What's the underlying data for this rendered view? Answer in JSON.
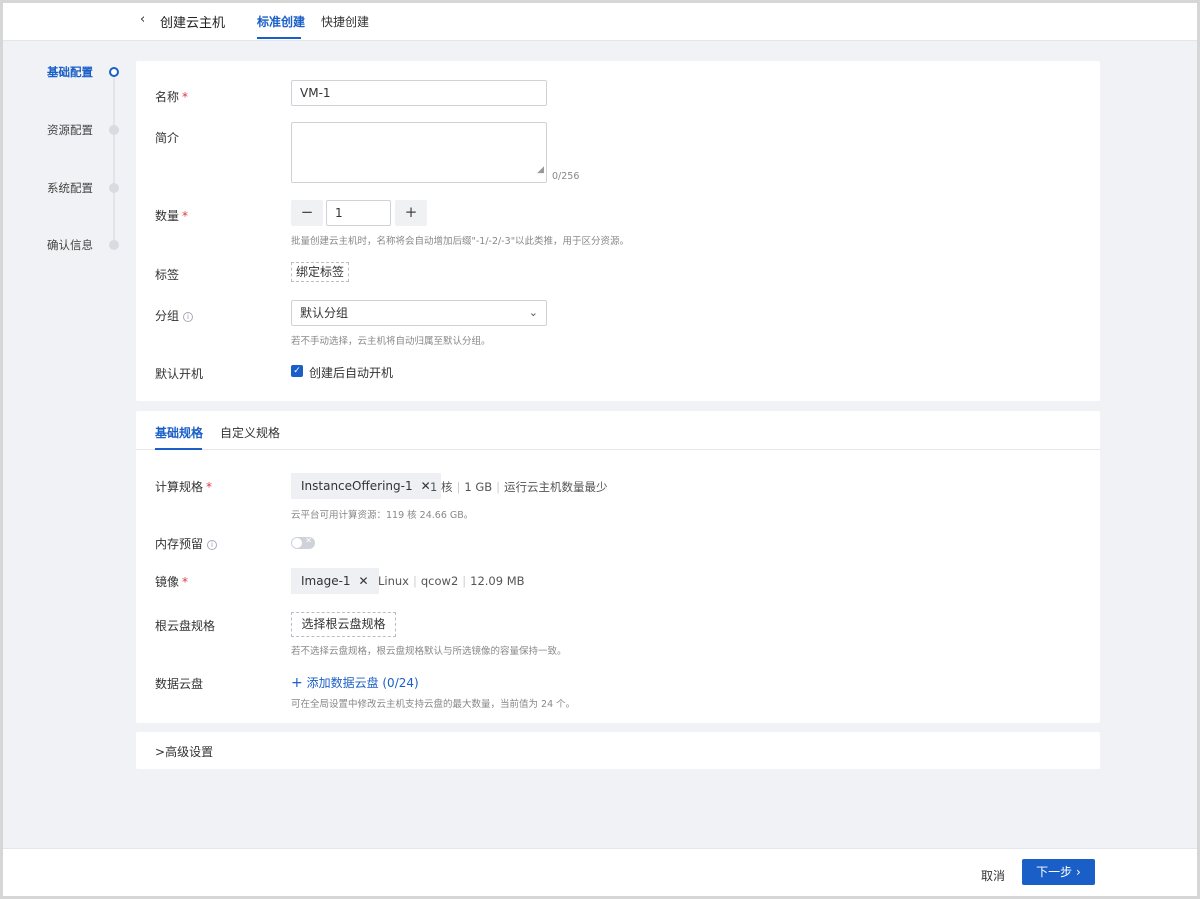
{
  "header": {
    "title": "创建云主机",
    "tabs": [
      {
        "label": "标准创建",
        "active": true
      },
      {
        "label": "快捷创建",
        "active": false
      }
    ]
  },
  "steps": [
    {
      "label": "基础配置",
      "active": true
    },
    {
      "label": "资源配置",
      "active": false
    },
    {
      "label": "系统配置",
      "active": false
    },
    {
      "label": "确认信息",
      "active": false
    }
  ],
  "basic": {
    "name_label": "名称",
    "name_value": "VM-1",
    "desc_label": "简介",
    "desc_value": "",
    "desc_counter": "0/256",
    "quantity_label": "数量",
    "quantity_value": "1",
    "quantity_minus": "−",
    "quantity_plus": "+",
    "quantity_hint": "批量创建云主机时，名称将会自动增加后缀\"-1/-2/-3\"以此类推，用于区分资源。",
    "tag_label": "标签",
    "tag_button": "绑定标签",
    "group_label": "分组",
    "group_value": "默认分组",
    "group_hint": "若不手动选择，云主机将自动归属至默认分组。",
    "poweron_label": "默认开机",
    "poweron_checkbox_label": "创建后自动开机",
    "poweron_checked": true,
    "required_mark": "*"
  },
  "spec": {
    "tabs": [
      {
        "label": "基础规格",
        "active": true
      },
      {
        "label": "自定义规格",
        "active": false
      }
    ],
    "compute_label": "计算规格",
    "compute_tag": "InstanceOffering-1",
    "compute_meta": [
      "1 核",
      "1 GB",
      "运行云主机数量最少"
    ],
    "compute_hint": "云平台可用计算资源：119 核 24.66 GB。",
    "memory_reserve_label": "内存预留",
    "memory_reserve_on": false,
    "image_label": "镜像",
    "image_tag": "Image-1",
    "image_meta": [
      "Linux",
      "qcow2",
      "12.09 MB"
    ],
    "rootdisk_label": "根云盘规格",
    "rootdisk_button": "选择根云盘规格",
    "rootdisk_hint": "若不选择云盘规格，根云盘规格默认与所选镜像的容量保持一致。",
    "datadisk_label": "数据云盘",
    "datadisk_link": "添加数据云盘 (0/24)",
    "datadisk_hint": "可在全局设置中修改云主机支持云盘的最大数量，当前值为 24 个。"
  },
  "advanced": {
    "label": "高级设置"
  },
  "footer": {
    "cancel": "取消",
    "next": "下一步"
  },
  "colors": {
    "accent": "#1a5fc7",
    "required": "#e0393e",
    "background": "#f0f2f5"
  },
  "icons": {
    "back": "chevron-left-icon",
    "info": "info-circle-icon",
    "dropdown": "chevron-down-icon",
    "close": "close-icon",
    "plus": "plus-icon",
    "expand": "chevron-right-icon"
  }
}
